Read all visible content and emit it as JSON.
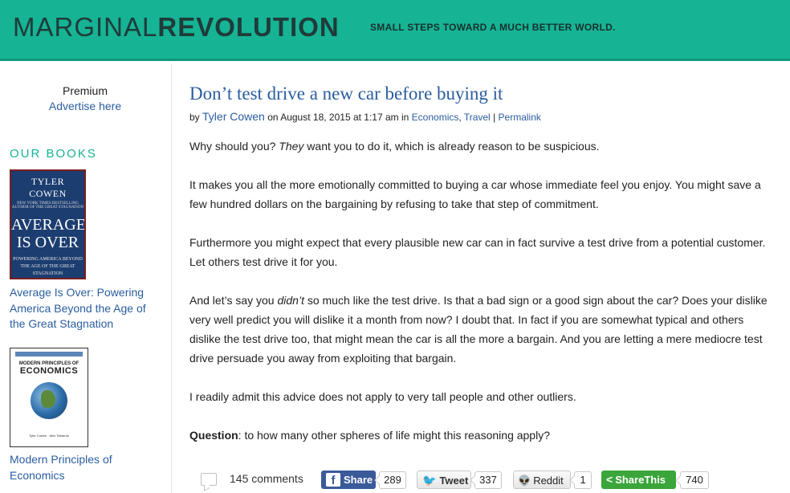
{
  "header": {
    "logo_thin": "MARGINAL",
    "logo_bold": "REVOLUTION",
    "tagline": "SMALL STEPS TOWARD A MUCH BETTER WORLD.",
    "background_color": "#16b394"
  },
  "sidebar": {
    "premium": "Premium",
    "advertise": "Advertise here",
    "books_heading": "OUR BOOKS",
    "book1": {
      "cover_author": "TYLER COWEN",
      "cover_blurb": "NEW YORK TIMES BESTSELLING AUTHOR OF THE GREAT STAGNATION",
      "cover_title_1": "AVERAGE",
      "cover_title_2": "IS OVER",
      "cover_subtitle": "POWERING AMERICA BEYOND THE AGE OF THE GREAT STAGNATION",
      "caption": "Average Is Over: Powering America Beyond the Age of the Great Stagnation"
    },
    "book2": {
      "cover_title_1": "MODERN PRINCIPLES OF",
      "cover_title_2": "ECONOMICS",
      "cover_authors": "Tyler Cowen · Alex Tabarrok",
      "caption": "Modern Principles of Economics"
    }
  },
  "post": {
    "title": "Don’t test drive a new car before buying it",
    "by": "by",
    "author": "Tyler Cowen",
    "date_prefix": "on August 18, 2015 at 1:17 am in",
    "category1": "Economics",
    "comma": ",",
    "category2": "Travel",
    "sep": "|",
    "permalink": "Permalink",
    "p1_a": "Why should you?  ",
    "p1_em": "They",
    "p1_b": " want you to do it, which is already reason to be suspicious.",
    "p2": "It makes you all the more emotionally committed to buying a car whose immediate feel you enjoy.  You might save a few hundred dollars on the bargaining by refusing to take that step of commitment.",
    "p3": "Furthermore you might expect that every plausible new car can in fact survive a test drive from a potential customer.  Let others test drive it for you.",
    "p4_a": "And let’s say you ",
    "p4_em": "didn’t",
    "p4_b": " so much like the test drive.  Is that a bad sign or a good sign about the car?  Does your dislike very well predict you will dislike it a month from now?  I doubt that.  In fact if you are somewhat typical and others dislike the test drive too, that might mean the car is all the more a bargain.  And you are letting a mere mediocre test drive persuade you away from exploiting that bargain.",
    "p5": "I readily admit this advice does not apply to very tall people and other outliers.",
    "p6_strong": "Question",
    "p6_rest": ": to how many other spheres of life might this reasoning apply?"
  },
  "share": {
    "comments": "145 comments",
    "facebook_icon": "f",
    "facebook_label": "Share",
    "facebook_count": "289",
    "twitter_icon": "🐦",
    "twitter_label": "Tweet",
    "twitter_count": "337",
    "reddit_icon": "👽",
    "reddit_label": "Reddit",
    "reddit_count": "1",
    "sharethis_icon": "<",
    "sharethis_label": "ShareThis",
    "sharethis_count": "740"
  }
}
